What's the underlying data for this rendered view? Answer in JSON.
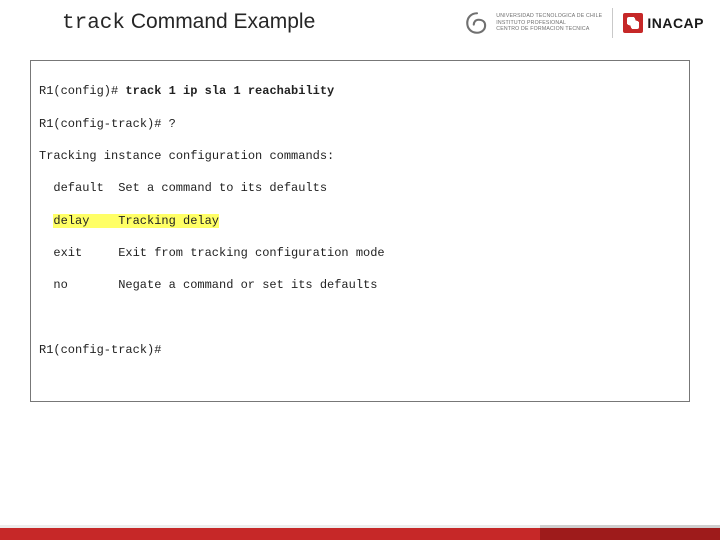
{
  "title": {
    "command": "track",
    "rest": " Command Example"
  },
  "logos": {
    "uni_lines": [
      "UNIVERSIDAD TECNOLOGICA DE CHILE",
      "INSTITUTO PROFESIONAL",
      "CENTRO DE FORMACION TECNICA"
    ],
    "inacap": "INACAP"
  },
  "terminal": {
    "line1_prompt": "R1(config)# ",
    "line1_cmd": "track 1 ip sla 1 reachability",
    "line2": "R1(config-track)# ?",
    "line3": "Tracking instance configuration commands:",
    "options": [
      {
        "kw": "default",
        "desc": "Set a command to its defaults",
        "hl": false
      },
      {
        "kw": "delay",
        "desc": "Tracking delay",
        "hl": true
      },
      {
        "kw": "exit",
        "desc": "Exit from tracking configuration mode",
        "hl": false
      },
      {
        "kw": "no",
        "desc": "Negate a command or set its defaults",
        "hl": false
      }
    ],
    "final_prompt": "R1(config-track)#"
  }
}
